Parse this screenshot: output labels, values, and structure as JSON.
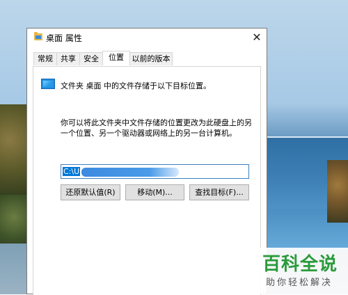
{
  "window": {
    "title": "桌面 属性",
    "close_symbol": "✕"
  },
  "tabs": [
    {
      "label": "常规"
    },
    {
      "label": "共享"
    },
    {
      "label": "安全"
    },
    {
      "label": "位置",
      "active": true
    },
    {
      "label": "以前的版本"
    }
  ],
  "location_tab": {
    "description": "文件夹 桌面 中的文件存储于以下目标位置。",
    "explanation": "你可以将此文件夹中文件存储的位置更改为此硬盘上的另一个位置、另一个驱动器或网络上的另一台计算机。",
    "path_value": "C:\\U",
    "buttons": {
      "restore": "还原默认值(R)",
      "move": "移动(M)...",
      "find_target": "查找目标(F)..."
    }
  },
  "watermark": {
    "title": "百科全说",
    "subtitle": "助你轻松解决"
  },
  "colors": {
    "selection": "#0078d7",
    "input_border": "#3c7fc1",
    "watermark_green": "#2a9b3a",
    "button_face": "#e1e1e1"
  },
  "icons": {
    "title_icon": "folder-icon",
    "location_icon": "desktop-folder-icon",
    "close": "close-icon"
  }
}
